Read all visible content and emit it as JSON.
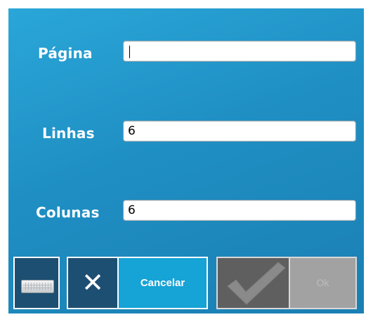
{
  "form": {
    "page": {
      "label": "Página",
      "value": ""
    },
    "rows": {
      "label": "Linhas",
      "value": "6"
    },
    "columns": {
      "label": "Colunas",
      "value": "6"
    }
  },
  "buttons": {
    "keyboard": {
      "icon": "keyboard-icon"
    },
    "cancel_icon": {
      "icon": "close-icon",
      "glyph": "✕"
    },
    "cancel": {
      "label": "Cancelar"
    },
    "confirm_icon": {
      "icon": "checkmark-icon"
    },
    "ok": {
      "label": "Ok"
    }
  },
  "colors": {
    "background": "#1f8fc3",
    "dark_button": "#1d4f72",
    "cancel_button": "#16a3d6",
    "disabled_dark": "#5f5f5f",
    "disabled_light": "#a2a2a2"
  }
}
